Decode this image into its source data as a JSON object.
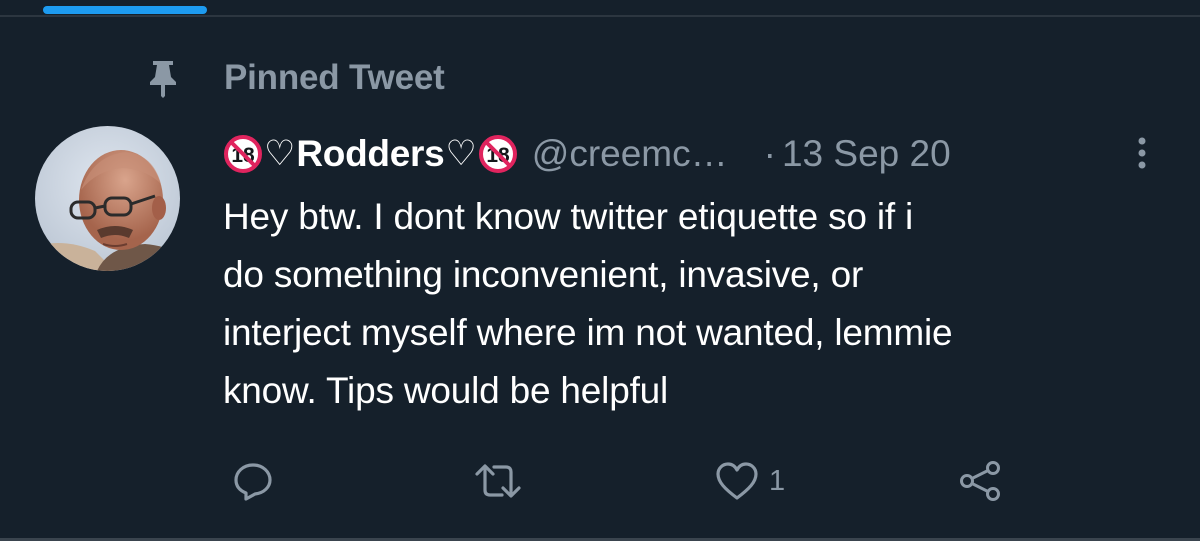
{
  "pinned": {
    "label": "Pinned Tweet",
    "icon": "pin-icon"
  },
  "tweet": {
    "avatar_icon": "avatar-portrait",
    "badge_icon": "no-under-18-icon",
    "display_name": "Rodders",
    "heart_glyph": "♡",
    "handle": "@creemc…",
    "separator": "·",
    "timestamp": "13 Sep 20",
    "more_icon": "more-vertical-icon",
    "text_lines": [
      "Hey btw. I dont know twitter etiquette so if i",
      "do something inconvenient, invasive, or",
      "interject myself where im not wanted, lemmie",
      "know. Tips would be helpful"
    ]
  },
  "actions": {
    "reply_icon": "reply-icon",
    "retweet_icon": "retweet-icon",
    "like_icon": "heart-icon",
    "like_count": "1",
    "share_icon": "share-icon"
  },
  "colors": {
    "background": "#15202b",
    "primary_text": "#ffffff",
    "secondary_text": "#8b98a5",
    "accent": "#1d9bf0",
    "badge_red": "#e0245e"
  }
}
